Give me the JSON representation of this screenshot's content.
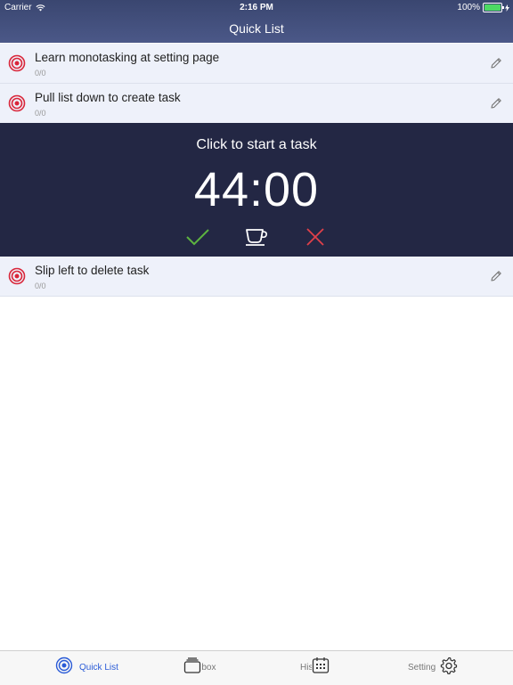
{
  "status_bar": {
    "carrier": "Carrier",
    "time": "2:16 PM",
    "battery": "100%"
  },
  "nav": {
    "title": "Quick List"
  },
  "tasks_top": [
    {
      "title": "Learn monotasking at setting page",
      "count": "0/0"
    },
    {
      "title": "Pull list down to create task",
      "count": "0/0"
    }
  ],
  "timer": {
    "prompt": "Click to start a task",
    "time": "44:00"
  },
  "tasks_bottom": [
    {
      "title": "Slip left to delete task",
      "count": "0/0"
    }
  ],
  "tabs": [
    {
      "label": "Quick List",
      "active": true
    },
    {
      "label": "Inbox"
    },
    {
      "label": "History"
    },
    {
      "label": "Setting"
    }
  ],
  "colors": {
    "header": "#3f4a78",
    "timer_bg": "#232744",
    "target_red": "#d9263a",
    "check_green": "#5cb340",
    "close_red": "#e0404a",
    "tab_active": "#2a5bd7"
  }
}
